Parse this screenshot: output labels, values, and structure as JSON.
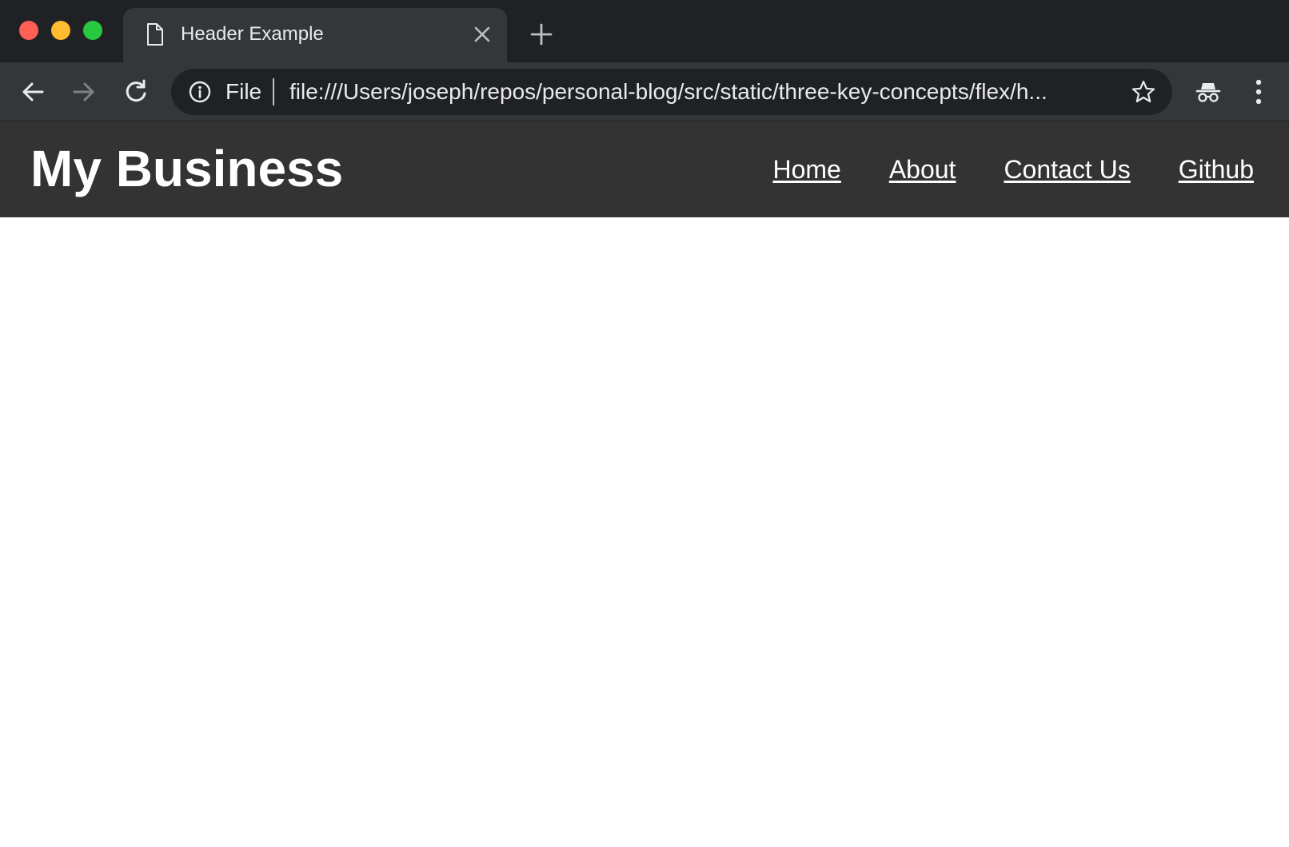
{
  "browser": {
    "tab": {
      "title": "Header Example",
      "icon": "document-icon"
    },
    "toolbar": {
      "scheme_label": "File",
      "url": "file:///Users/joseph/repos/personal-blog/src/static/three-key-concepts/flex/h..."
    },
    "colors": {
      "tabstrip_bg": "#202124",
      "toolbar_bg": "#35363a",
      "omnibox_bg": "#202124",
      "close_light": "#fe5f57",
      "minimize_light": "#febc2e",
      "maximize_light": "#28c840"
    }
  },
  "page": {
    "header": {
      "title": "My Business",
      "background": "#333333",
      "nav": [
        {
          "label": "Home"
        },
        {
          "label": "About"
        },
        {
          "label": "Contact Us"
        },
        {
          "label": "Github"
        }
      ]
    }
  }
}
